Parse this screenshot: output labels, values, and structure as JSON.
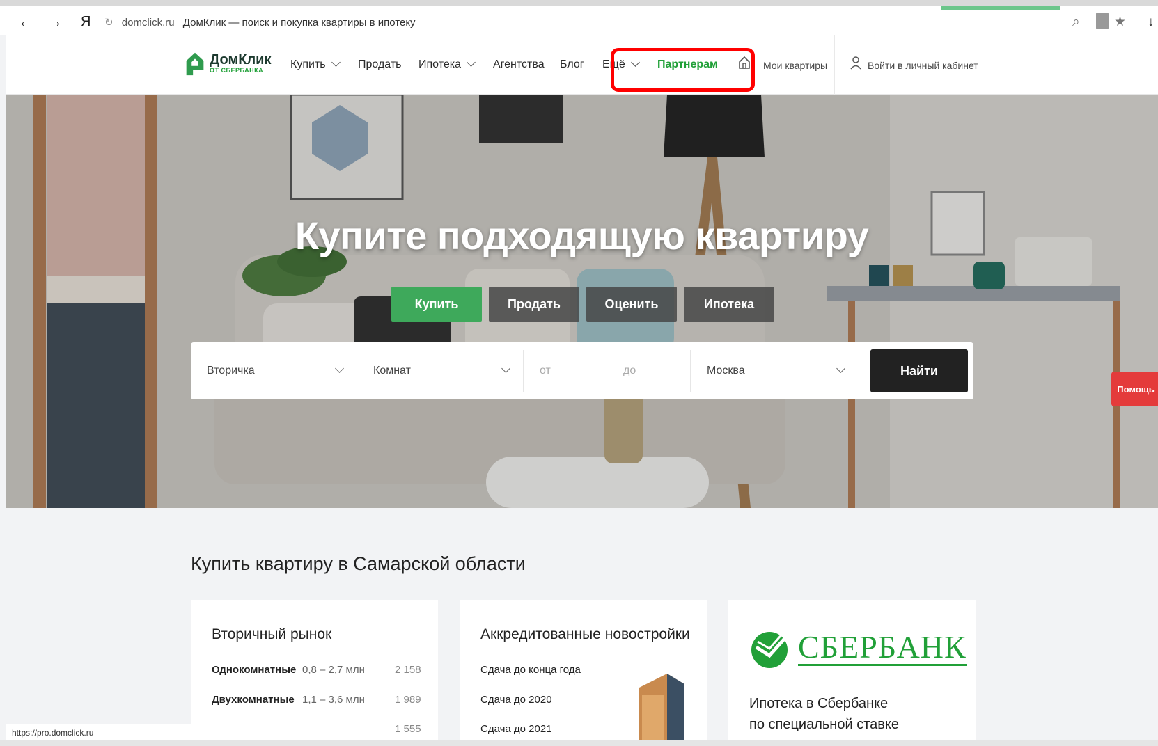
{
  "browser": {
    "back": "←",
    "forward": "→",
    "ya": "Я",
    "reload": "↻",
    "domain": "domclick.ru",
    "page_title": "ДомКлик — поиск и покупка квартиры в ипотеку"
  },
  "header": {
    "logo_main": "ДомКлик",
    "logo_sub": "ОТ СБЕРБАНКА",
    "nav": {
      "buy": "Купить",
      "sell": "Продать",
      "mortgage": "Ипотека",
      "agencies": "Агентства",
      "blog": "Блог",
      "more": "Ещё",
      "partners": "Партнерам"
    },
    "my_flats": "Мои квартиры",
    "login": "Войти в личный кабинет"
  },
  "hero": {
    "title": "Купите подходящую квартиру",
    "tabs": [
      "Купить",
      "Продать",
      "Оценить",
      "Ипотека"
    ],
    "search": {
      "type": "Вторичка",
      "rooms": "Комнат",
      "from": "от",
      "to": "до",
      "city": "Москва",
      "button": "Найти"
    },
    "help": "Помощь"
  },
  "section": {
    "title": "Купить квартиру в Самарской области",
    "secondary": {
      "title": "Вторичный рынок",
      "rows": [
        {
          "label": "Однокомнатные",
          "range": "0,8 – 2,7 млн",
          "count": "2 158"
        },
        {
          "label": "Двухкомнатные",
          "range": "1,1 – 3,6 млн",
          "count": "1 989"
        },
        {
          "label": "",
          "range": "",
          "count": "1 555"
        }
      ]
    },
    "new_buildings": {
      "title": "Аккредитованные новостройки",
      "items": [
        "Сдача до конца года",
        "Сдача до 2020",
        "Сдача до 2021"
      ]
    },
    "sber": {
      "brand": "СБЕРБАНК",
      "line1": "Ипотека в Сбербанке",
      "line2": "по специальной ставке"
    }
  },
  "status_url": "https://pro.domclick.ru",
  "colors": {
    "brand_green": "#21a038",
    "tab_active": "#3ea95b",
    "highlight_red": "#ff0000",
    "help_red": "#e43b3b"
  }
}
